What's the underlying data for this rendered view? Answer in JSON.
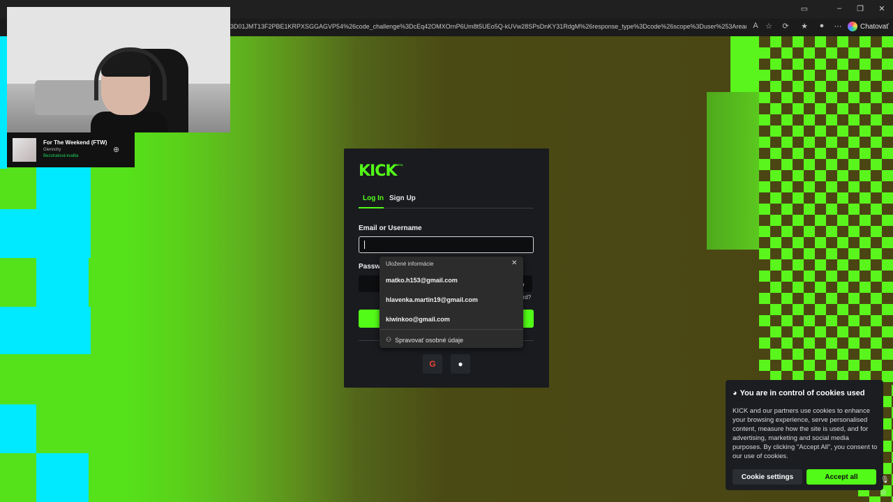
{
  "browser": {
    "url": "3D01JMT13F2PBE1KRPXSGGAGVP54%26code_challenge%3DcEq42OMXOrnP6Um8t5UEo5Q-kUVw28SPsDnKY31RdgM%26response_type%3Dcode%26scope%3Duser%253Aread...",
    "chat_label": "Chatovať"
  },
  "spotify": {
    "title": "For The Weekend (FTW)",
    "artist": "Glennchy",
    "quality": "Bezstratová kvalita"
  },
  "login": {
    "logo": "KICK",
    "beta": "BETA",
    "tab_login": "Log In",
    "tab_signup": "Sign Up",
    "email_label": "Email or Username",
    "password_label": "Passw",
    "forgot_partial": "ord?"
  },
  "autofill": {
    "header": "Uložené informácie",
    "items": [
      "matko.h153@gmail.com",
      "hlavenka.martin19@gmail.com",
      "kiwinkoo@gmail.com"
    ],
    "manage": "Spravovať osobné údaje"
  },
  "cookie": {
    "title": "You are in control of cookies used",
    "body": "KICK and our partners use cookies to enhance your browsing experience, serve personalised content, measure how the site is used, and for advertising, marketing and social media purposes. By clicking \"Accept All\", you consent to our use of cookies.",
    "settings_label": "Cookie settings",
    "accept_label": "Accept all"
  },
  "colors": {
    "accent": "#53fc18",
    "modal_bg": "#191b1f"
  },
  "icons": [
    "read-aloud-icon",
    "favorite-star-icon",
    "extensions-icon",
    "favorites-icon",
    "profile-icon",
    "more-icon",
    "minimize-icon",
    "restore-icon",
    "close-icon",
    "google-icon",
    "apple-icon",
    "cookie-icon",
    "mic-icon"
  ]
}
